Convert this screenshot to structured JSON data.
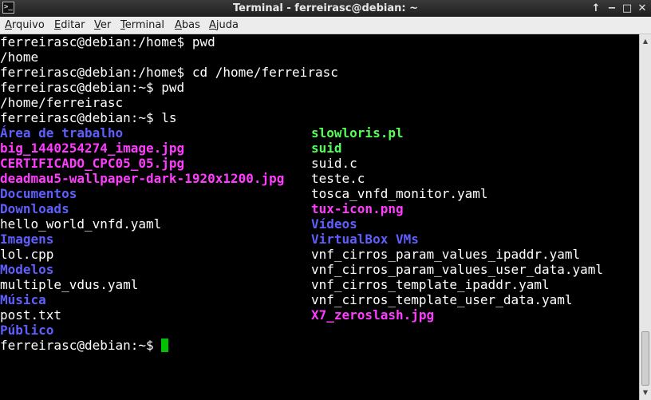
{
  "window": {
    "title": "Terminal - ferreirasc@debian: ~",
    "controls": {
      "up": "↑",
      "minimize": "−",
      "maximize": "□",
      "close": "✕"
    },
    "icon": "terminal-icon"
  },
  "menubar": {
    "items": [
      {
        "mnemonic": "A",
        "rest": "rquivo"
      },
      {
        "mnemonic": "E",
        "rest": "ditar"
      },
      {
        "mnemonic": "V",
        "rest": "er"
      },
      {
        "mnemonic": "T",
        "rest": "erminal"
      },
      {
        "mnemonic": "A",
        "rest": "bas"
      },
      {
        "mnemonic": "A",
        "rest": "juda"
      }
    ]
  },
  "terminal": {
    "lines": [
      "ferreirasc@debian:/home$ pwd",
      "/home",
      "ferreirasc@debian:/home$ cd /home/ferreirasc",
      "ferreirasc@debian:~$ pwd",
      "/home/ferreirasc",
      "ferreirasc@debian:~$ ls"
    ],
    "ls_col1": [
      {
        "name": "Área de trabalho",
        "kind": "dir"
      },
      {
        "name": "big_1440254274_image.jpg",
        "kind": "img"
      },
      {
        "name": "CERTIFICADO_CPC05_05.jpg",
        "kind": "img"
      },
      {
        "name": "deadmau5-wallpaper-dark-1920x1200.jpg",
        "kind": "img"
      },
      {
        "name": "Documentos",
        "kind": "dir"
      },
      {
        "name": "Downloads",
        "kind": "dir"
      },
      {
        "name": "hello_world_vnfd.yaml",
        "kind": "txt"
      },
      {
        "name": "Imagens",
        "kind": "dir"
      },
      {
        "name": "lol.cpp",
        "kind": "txt"
      },
      {
        "name": "Modelos",
        "kind": "dir"
      },
      {
        "name": "multiple_vdus.yaml",
        "kind": "txt"
      },
      {
        "name": "Música",
        "kind": "dir"
      },
      {
        "name": "post.txt",
        "kind": "txt"
      },
      {
        "name": "Público",
        "kind": "dir"
      }
    ],
    "ls_col2": [
      {
        "name": "slowloris.pl",
        "kind": "exe"
      },
      {
        "name": "suid",
        "kind": "exe"
      },
      {
        "name": "suid.c",
        "kind": "txt"
      },
      {
        "name": "teste.c",
        "kind": "txt"
      },
      {
        "name": "tosca_vnfd_monitor.yaml",
        "kind": "txt"
      },
      {
        "name": "tux-icon.png",
        "kind": "img"
      },
      {
        "name": "Vídeos",
        "kind": "dir"
      },
      {
        "name": "VirtualBox VMs",
        "kind": "dir"
      },
      {
        "name": "vnf_cirros_param_values_ipaddr.yaml",
        "kind": "txt"
      },
      {
        "name": "vnf_cirros_param_values_user_data.yaml",
        "kind": "txt"
      },
      {
        "name": "vnf_cirros_template_ipaddr.yaml",
        "kind": "txt"
      },
      {
        "name": "vnf_cirros_template_user_data.yaml",
        "kind": "txt"
      },
      {
        "name": "X7_zeroslash.jpg",
        "kind": "img"
      }
    ],
    "prompt": "ferreirasc@debian:~$ "
  },
  "colors": {
    "dir": "#5f5fff",
    "img": "#ff3cff",
    "exe": "#55ff55",
    "cursor": "#00c000"
  }
}
